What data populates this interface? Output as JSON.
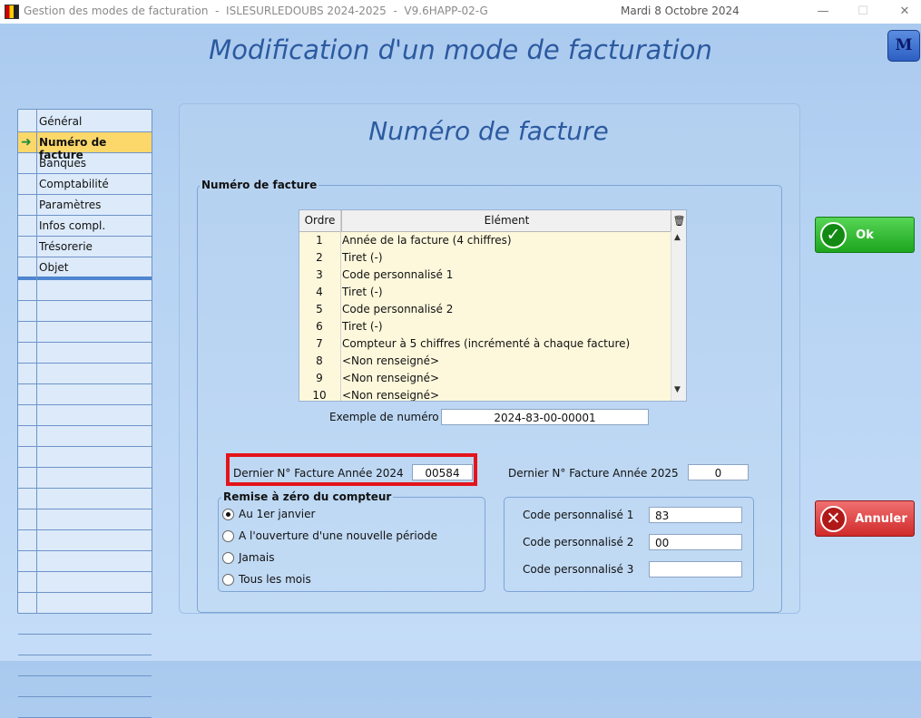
{
  "window": {
    "title": "Gestion des modes de facturation  -  ISLESURLEDOUBS 2024-2025  -  V9.6HAPP-02-G",
    "date": "Mardi 8 Octobre 2024",
    "minimize": "—",
    "maximize": "☐",
    "close": "✕"
  },
  "header": {
    "title": "Modification d'un mode de facturation",
    "badge": "M"
  },
  "sidebar": {
    "items": [
      {
        "label": "Général"
      },
      {
        "label": "Numéro de facture",
        "active": true
      },
      {
        "label": "Banques"
      },
      {
        "label": "Comptabilité"
      },
      {
        "label": "Paramètres"
      },
      {
        "label": "Infos compl."
      },
      {
        "label": "Trésorerie"
      },
      {
        "label": "Objet"
      }
    ],
    "arrow": "➜"
  },
  "panel": {
    "title": "Numéro de facture",
    "group_title": "Numéro de facture",
    "grid": {
      "col_ordre": "Ordre",
      "col_element": "Elément",
      "rows": [
        {
          "ordre": "1",
          "element": "Année de la facture (4 chiffres)"
        },
        {
          "ordre": "2",
          "element": "Tiret (-)"
        },
        {
          "ordre": "3",
          "element": "Code personnalisé 1"
        },
        {
          "ordre": "4",
          "element": "Tiret (-)"
        },
        {
          "ordre": "5",
          "element": "Code personnalisé 2"
        },
        {
          "ordre": "6",
          "element": "Tiret (-)"
        },
        {
          "ordre": "7",
          "element": "Compteur à 5 chiffres (incrémenté à chaque facture)"
        },
        {
          "ordre": "8",
          "element": "<Non renseigné>"
        },
        {
          "ordre": "9",
          "element": "<Non renseigné>"
        },
        {
          "ordre": "10",
          "element": "<Non renseigné>"
        }
      ]
    },
    "example_label": "Exemple de numéro",
    "example_value": "2024-83-00-00001",
    "last_2024_label": "Dernier N° Facture Année 2024",
    "last_2024_value": "00584",
    "last_2025_label": "Dernier N° Facture Année 2025",
    "last_2025_value": "0",
    "reset": {
      "title": "Remise à zéro du compteur",
      "options": [
        "Au 1er janvier",
        "A l'ouverture d'une nouvelle période",
        "Jamais",
        "Tous les mois"
      ],
      "selected": 0
    },
    "codes": {
      "code1_label": "Code personnalisé 1",
      "code1_value": "83",
      "code2_label": "Code personnalisé 2",
      "code2_value": "00",
      "code3_label": "Code personnalisé 3",
      "code3_value": ""
    }
  },
  "buttons": {
    "ok": "Ok",
    "cancel": "Annuler"
  },
  "colors": {
    "title_blue": "#2c5aa0",
    "active_item": "#fcd86a",
    "highlight_red": "#e4141b",
    "ok_green": "#1ea51e",
    "cancel_red": "#d02a2a"
  }
}
